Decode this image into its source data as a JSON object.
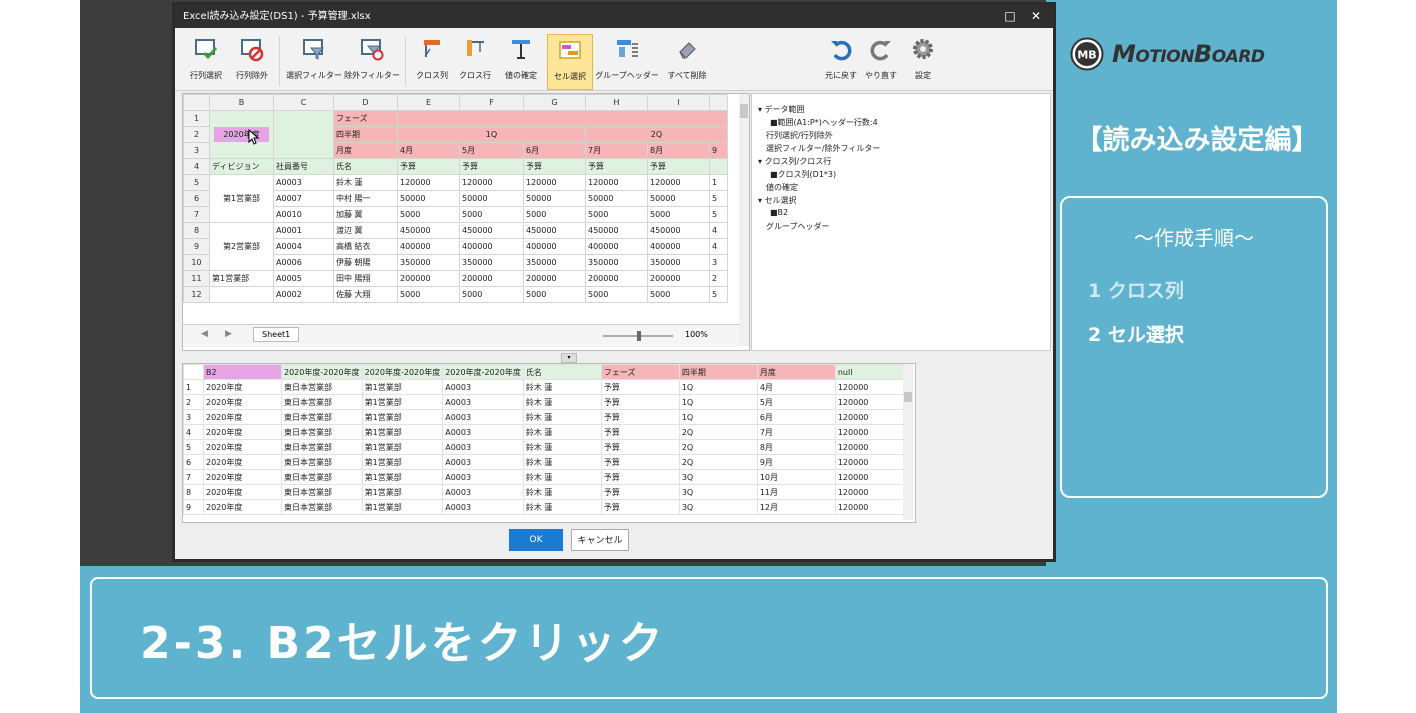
{
  "window": {
    "title": "Excel読み込み設定(DS1) - 予算管理.xlsx"
  },
  "toolbar": {
    "row_select": "行列選択",
    "row_exclude": "行列除外",
    "select_filter": "選択フィルター",
    "exclude_filter": "除外フィルター",
    "cross_column": "クロス列",
    "cross_row": "クロス行",
    "value_confirm": "値の確定",
    "cell_select": "セル選択",
    "group_header": "グループヘッダー",
    "clear_all": "すべて削除",
    "undo": "元に戻す",
    "redo": "やり直す",
    "settings": "設定"
  },
  "grid": {
    "col_headers": [
      "B",
      "C",
      "D",
      "E",
      "F",
      "G",
      "H",
      "I"
    ],
    "row_numbers": [
      "1",
      "2",
      "3",
      "4",
      "5",
      "6",
      "7",
      "8",
      "9",
      "10",
      "11",
      "12"
    ],
    "b2": "2020年度",
    "d1": "フェーズ",
    "d2": "四半期",
    "d3": "月度",
    "q1": "1Q",
    "q2": "2Q",
    "months": [
      "4月",
      "5月",
      "6月",
      "7月",
      "8月"
    ],
    "row4": [
      "ディビジョン",
      "社員番号",
      "氏名",
      "予算",
      "予算",
      "予算",
      "予算",
      "予算"
    ],
    "div1": "第1営業部",
    "div2": "第2営業部",
    "div3": "第1営業部",
    "row5": [
      "A0003",
      "鈴木 蓮",
      "120000",
      "120000",
      "120000",
      "120000",
      "120000"
    ],
    "row6": [
      "A0007",
      "中村 陽一",
      "50000",
      "50000",
      "50000",
      "50000",
      "50000"
    ],
    "row7": [
      "A0010",
      "加藤 翼",
      "5000",
      "5000",
      "5000",
      "5000",
      "5000"
    ],
    "row8": [
      "A0001",
      "渡辺 翼",
      "450000",
      "450000",
      "450000",
      "450000",
      "450000"
    ],
    "row9": [
      "A0004",
      "高橋 結衣",
      "400000",
      "400000",
      "400000",
      "400000",
      "400000"
    ],
    "row10": [
      "A0006",
      "伊藤 朝陽",
      "350000",
      "350000",
      "350000",
      "350000",
      "350000"
    ],
    "row11": [
      "A0005",
      "田中 陽翔",
      "200000",
      "200000",
      "200000",
      "200000",
      "200000"
    ],
    "row12": [
      "A0002",
      "佐藤 大翔",
      "5000",
      "5000",
      "5000",
      "5000",
      "5000"
    ],
    "col_J_partial": [
      "1",
      "5",
      "5",
      "4",
      "4",
      "3",
      "2",
      "5"
    ],
    "col_J_header": "9",
    "sheet_tab": "Sheet1",
    "zoom": "100%"
  },
  "tree": {
    "data_range": "データ範囲",
    "range_detail": "■範囲(A1:P*)ヘッダー行数:4",
    "row_select": "行列選択/行列除外",
    "select_filter": "選択フィルター/除外フィルター",
    "cross": "クロス列/クロス行",
    "cross_detail": "■クロス列(D1*3)",
    "value_confirm": "値の確定",
    "cell_select": "セル選択",
    "cell_detail": "■B2",
    "group_header": "グループヘッダー"
  },
  "preview": {
    "headers": [
      "B2",
      "2020年度-2020年度",
      "2020年度-2020年度",
      "2020年度-2020年度",
      "氏名",
      "フェーズ",
      "四半期",
      "月度",
      "null"
    ],
    "rows": [
      [
        "1",
        "2020年度",
        "東日本営業部",
        "第1営業部",
        "A0003",
        "鈴木 蓮",
        "予算",
        "1Q",
        "4月",
        "120000"
      ],
      [
        "2",
        "2020年度",
        "東日本営業部",
        "第1営業部",
        "A0003",
        "鈴木 蓮",
        "予算",
        "1Q",
        "5月",
        "120000"
      ],
      [
        "3",
        "2020年度",
        "東日本営業部",
        "第1営業部",
        "A0003",
        "鈴木 蓮",
        "予算",
        "1Q",
        "6月",
        "120000"
      ],
      [
        "4",
        "2020年度",
        "東日本営業部",
        "第1営業部",
        "A0003",
        "鈴木 蓮",
        "予算",
        "2Q",
        "7月",
        "120000"
      ],
      [
        "5",
        "2020年度",
        "東日本営業部",
        "第1営業部",
        "A0003",
        "鈴木 蓮",
        "予算",
        "2Q",
        "8月",
        "120000"
      ],
      [
        "6",
        "2020年度",
        "東日本営業部",
        "第1営業部",
        "A0003",
        "鈴木 蓮",
        "予算",
        "2Q",
        "9月",
        "120000"
      ],
      [
        "7",
        "2020年度",
        "東日本営業部",
        "第1営業部",
        "A0003",
        "鈴木 蓮",
        "予算",
        "3Q",
        "10月",
        "120000"
      ],
      [
        "8",
        "2020年度",
        "東日本営業部",
        "第1営業部",
        "A0003",
        "鈴木 蓮",
        "予算",
        "3Q",
        "11月",
        "120000"
      ],
      [
        "9",
        "2020年度",
        "東日本営業部",
        "第1営業部",
        "A0003",
        "鈴木 蓮",
        "予算",
        "3Q",
        "12月",
        "120000"
      ]
    ]
  },
  "buttons": {
    "ok": "OK",
    "cancel": "キャンセル"
  },
  "brand": {
    "badge": "MB",
    "name": "MotionBoard"
  },
  "section_title": "【読み込み設定編】",
  "steps": {
    "heading": "～作成手順～",
    "step1": "1 クロス列",
    "step2": "2 セル選択"
  },
  "caption": "2-3. B2セルをクリック",
  "colors": {
    "teal": "#5fb3ce",
    "pink": "#f6b6b8",
    "green": "#dff2df",
    "magenta": "#e6a4e4",
    "highlight": "#fde59a",
    "ok_blue": "#1b7bd1"
  }
}
